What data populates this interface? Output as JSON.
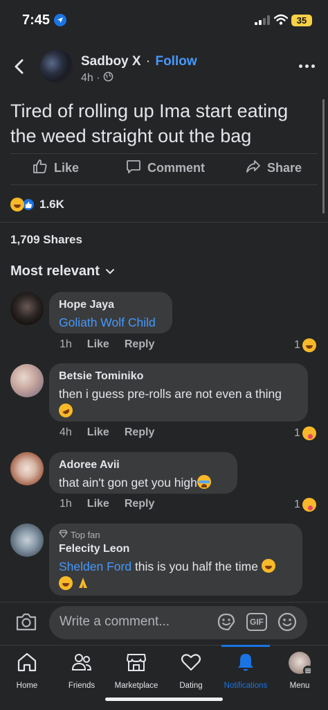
{
  "status_bar": {
    "time": "7:45",
    "battery": "35"
  },
  "post": {
    "author": "Sadboy X",
    "separator": "·",
    "follow_label": "Follow",
    "time": "4h ·",
    "text": "Tired of rolling up Ima start eating the weed straight out the bag",
    "actions": {
      "like": "Like",
      "comment": "Comment",
      "share": "Share"
    },
    "reaction_count": "1.6K",
    "shares": "1,709 Shares",
    "sort_label": "Most relevant"
  },
  "comments": [
    {
      "name": "Hope Jaya",
      "mention": "Goliath Wolf Child",
      "text": "",
      "time": "1h",
      "like": "Like",
      "reply": "Reply",
      "count": "1"
    },
    {
      "name": "Betsie Tominiko",
      "text": "then i guess pre-rolls are not even a thing",
      "time": "4h",
      "like": "Like",
      "reply": "Reply",
      "count": "1"
    },
    {
      "name": "Adoree Avii",
      "text": "that ain't gon get you high",
      "time": "1h",
      "like": "Like",
      "reply": "Reply",
      "count": "1"
    },
    {
      "badge": "Top fan",
      "name": "Felecity Leon",
      "mention": "Shelden Ford",
      "text": " this is you half the time "
    }
  ],
  "composer": {
    "placeholder": "Write a comment...",
    "gif": "GIF"
  },
  "tabs": [
    {
      "label": "Home"
    },
    {
      "label": "Friends"
    },
    {
      "label": "Marketplace"
    },
    {
      "label": "Dating"
    },
    {
      "label": "Notifications"
    },
    {
      "label": "Menu"
    }
  ],
  "colors": {
    "background": "#242526",
    "accent": "#4599ff",
    "bubble": "#3a3b3c"
  }
}
